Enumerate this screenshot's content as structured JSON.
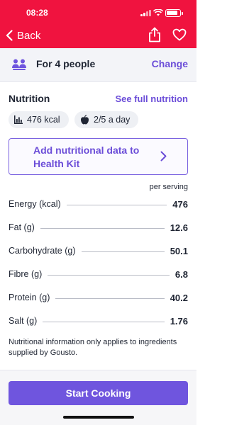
{
  "status_bar": {
    "time": "08:28"
  },
  "nav": {
    "back_label": "Back",
    "icons": [
      "chevron-left-icon",
      "share-icon",
      "heart-icon"
    ]
  },
  "servings": {
    "icon": "people-icon",
    "text": "For 4 people",
    "change_label": "Change"
  },
  "nutrition": {
    "title": "Nutrition",
    "see_full_label": "See full nutrition",
    "chips": [
      {
        "icon": "bar-chart-icon",
        "label": "476 kcal"
      },
      {
        "icon": "apple-icon",
        "label": "2/5 a day"
      }
    ],
    "health_kit_label": "Add nutritional data to Health Kit",
    "per_serving_label": "per serving",
    "rows": [
      {
        "label": "Energy (kcal)",
        "value": "476"
      },
      {
        "label": "Fat (g)",
        "value": "12.6"
      },
      {
        "label": "Carbohydrate (g)",
        "value": "50.1"
      },
      {
        "label": "Fibre (g)",
        "value": "6.8"
      },
      {
        "label": "Protein (g)",
        "value": "40.2"
      },
      {
        "label": "Salt (g)",
        "value": "1.76"
      }
    ],
    "disclaimer": "Nutritional information only applies to ingredients supplied by Gousto."
  },
  "footer": {
    "start_label": "Start Cooking"
  },
  "colors": {
    "brand_red": "#f0133f",
    "accent_purple": "#6b4dd8",
    "button_purple": "#6f55de"
  }
}
